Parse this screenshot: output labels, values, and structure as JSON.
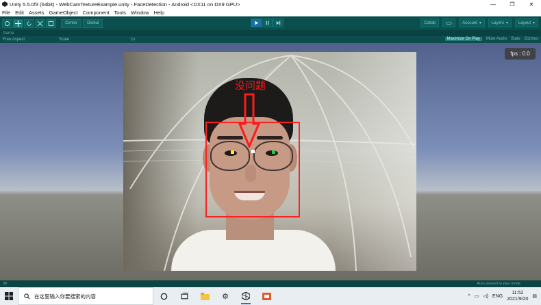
{
  "window": {
    "title": "Unity 5.5.0f3 (64bit) - WebCamTextureExample.unity - FaceDetection - Android <DX11 on DX9 GPU>",
    "minimize": "—",
    "maximize": "❐",
    "close": "✕"
  },
  "menu": [
    "File",
    "Edit",
    "Assets",
    "GameObject",
    "Component",
    "Tools",
    "Window",
    "Help"
  ],
  "toolbar": {
    "pivot_label": "Center",
    "space_label": "Global",
    "collab_label": "Collab",
    "account_label": "Account",
    "layers_label": "Layers",
    "layout_label": "Layout"
  },
  "tabs": {
    "game_tab": "Game"
  },
  "gamebar": {
    "aspect": "Free Aspect",
    "scale_label": "Scale",
    "scale_value": "1x",
    "maximize_on_play": "Maximize On Play",
    "mute_audio": "Mute Audio",
    "stats": "Stats",
    "gizmos": "Gizmos"
  },
  "game": {
    "fps_text": "fps : 0.0",
    "annotation": "没问题"
  },
  "status": {
    "left": "08",
    "right": "Auto paused in play mode"
  },
  "taskbar": {
    "search_placeholder": "在这里输入你要搜索的内容",
    "lang": "ENG",
    "time": "11:52",
    "date": "2021/9/20"
  },
  "colors": {
    "unity_teal": "#0b4e4e",
    "face_rect": "#ff2020",
    "annotation": "#ff1a1a",
    "landmark_left": "#ffee22",
    "landmark_center": "#ffffff",
    "landmark_right": "#10d040"
  }
}
